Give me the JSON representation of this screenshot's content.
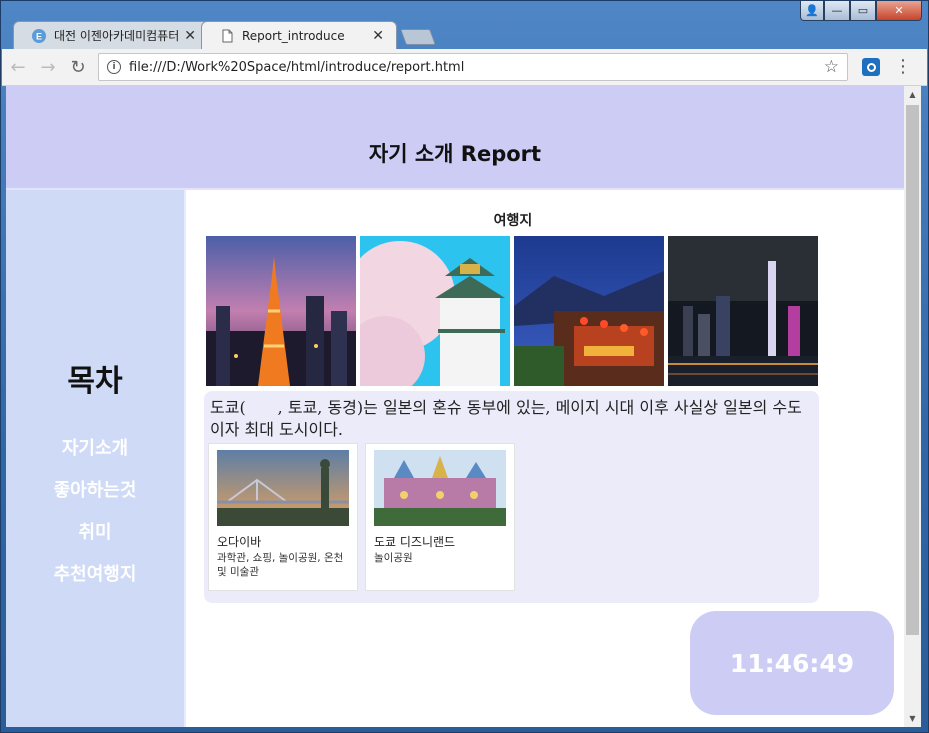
{
  "browser": {
    "tabs": [
      {
        "title": "대전 이젠아카데미컴퓨터",
        "active": false
      },
      {
        "title": "Report_introduce",
        "active": true
      }
    ],
    "url": "file:///D:/Work%20Space/html/introduce/report.html"
  },
  "page": {
    "header_title": "자기 소개 Report",
    "sidebar": {
      "toc_title": "목차",
      "items": [
        "자기소개",
        "좋아하는것",
        "취미",
        "추천여행지"
      ]
    },
    "section_title": "여행지",
    "photos": [
      {
        "icon": "tokyo-tower-night-photo"
      },
      {
        "icon": "osaka-castle-cherry-blossom-photo"
      },
      {
        "icon": "jiufen-lanterns-photo"
      },
      {
        "icon": "hong-kong-skyline-photo"
      }
    ],
    "description": "도쿄(　　, 토쿄, 동경)는 일본의 혼슈 동부에 있는, 메이지 시대 이후 사실상 일본의 수도이자 최대 도시이다.",
    "cards": [
      {
        "name": "오다이바",
        "sub": "과학관, 쇼핑, 놀이공원, 온천 및 미술관"
      },
      {
        "name": "도쿄 디즈니랜드",
        "sub": "놀이공원"
      }
    ],
    "clock": "11:46:49"
  },
  "colors": {
    "header_bg": "#ccccf5",
    "sidebar_bg": "#cfdaf7",
    "infobox_bg": "#ecebfa",
    "clock_bg": "#ccccf5"
  }
}
